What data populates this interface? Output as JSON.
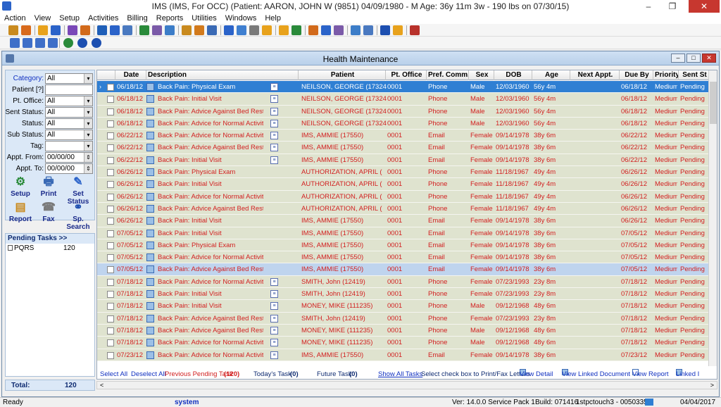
{
  "window": {
    "title": "IMS (IMS, For OCC)    (Patient: AARON, JOHN W (9851) 04/09/1980 - M Age: 36y 11m 3w - 190 lbs on 07/30/15)",
    "min": "–",
    "max": "❐",
    "close": "✕"
  },
  "menu": [
    "Action",
    "View",
    "Setup",
    "Activities",
    "Billing",
    "Reports",
    "Utilities",
    "Windows",
    "Help"
  ],
  "mdi": {
    "title": "Health Maintenance",
    "min": "–",
    "max": "□",
    "close": "✕"
  },
  "filters": [
    {
      "label": "Category:",
      "value": "All",
      "link": true
    },
    {
      "label": "Patient [?]",
      "value": "",
      "link": false
    },
    {
      "label": "Pt. Office:",
      "value": "All",
      "link": false
    },
    {
      "label": "Sent Status:",
      "value": "All",
      "link": false
    },
    {
      "label": "Status:",
      "value": "All",
      "link": false
    },
    {
      "label": "Sub Status:",
      "value": "All",
      "link": false
    },
    {
      "label": "Tag:",
      "value": "",
      "link": false
    },
    {
      "label": "Appt. From:",
      "value": "00/00/00",
      "link": false
    },
    {
      "label": "Appt. To:",
      "value": "00/00/00",
      "link": false
    }
  ],
  "actions": [
    {
      "label": "Setup",
      "icon": "gear-icon",
      "glyph": "⚙"
    },
    {
      "label": "Print",
      "icon": "printer-icon",
      "glyph": "🖶"
    },
    {
      "label": "Set Status",
      "icon": "edit-status-icon",
      "glyph": "✎"
    },
    {
      "label": "Report",
      "icon": "report-icon",
      "glyph": "▤"
    },
    {
      "label": "Fax",
      "icon": "fax-icon",
      "glyph": "☎"
    },
    {
      "label": "Sp. Search",
      "icon": "binoculars-icon",
      "glyph": "⚭"
    }
  ],
  "pending": {
    "header": "Pending Tasks >>",
    "items": [
      {
        "name": "PQRS",
        "count": "120"
      }
    ]
  },
  "total": {
    "label": "Total:",
    "value": "120"
  },
  "columns": [
    "Date",
    "Description",
    "Patient",
    "Pt. Office",
    "Pref. Comm.",
    "Sex",
    "DOB",
    "Age",
    "Next Appt.",
    "Due By",
    "Priority",
    "Sent St"
  ],
  "rows": [
    {
      "date": "06/18/12",
      "desc": "Back Pain: Physical Exam",
      "rep": true,
      "patient": "NEILSON, GEORGE  (17324",
      "office": "0001",
      "comm": "Phone",
      "sex": "Male",
      "dob": "12/03/1960",
      "age": "56y 4m",
      "next": "",
      "due": "06/18/12",
      "priority": "Medium",
      "sent": "Pending",
      "state": "sel1"
    },
    {
      "date": "06/18/12",
      "desc": "Back Pain: Initial Visit",
      "rep": true,
      "patient": "NEILSON, GEORGE  (17324",
      "office": "0001",
      "comm": "Phone",
      "sex": "Male",
      "dob": "12/03/1960",
      "age": "56y 4m",
      "next": "",
      "due": "06/18/12",
      "priority": "Medium",
      "sent": "Pending",
      "state": ""
    },
    {
      "date": "06/18/12",
      "desc": "Back Pain: Advice Against Bed Rest",
      "rep": true,
      "patient": "NEILSON, GEORGE  (17324",
      "office": "0001",
      "comm": "Phone",
      "sex": "Male",
      "dob": "12/03/1960",
      "age": "56y 4m",
      "next": "",
      "due": "06/18/12",
      "priority": "Medium",
      "sent": "Pending",
      "state": ""
    },
    {
      "date": "06/18/12",
      "desc": "Back Pain: Advice for Normal Activities",
      "rep": true,
      "patient": "NEILSON, GEORGE  (17324",
      "office": "0001",
      "comm": "Phone",
      "sex": "Male",
      "dob": "12/03/1960",
      "age": "56y 4m",
      "next": "",
      "due": "06/18/12",
      "priority": "Medium",
      "sent": "Pending",
      "state": ""
    },
    {
      "date": "06/22/12",
      "desc": "Back Pain: Advice for Normal Activities",
      "rep": true,
      "patient": "IMS, AMMIE  (17550)",
      "office": "0001",
      "comm": "Email",
      "sex": "Female",
      "dob": "09/14/1978",
      "age": "38y 6m",
      "next": "",
      "due": "06/22/12",
      "priority": "Medium",
      "sent": "Pending",
      "state": ""
    },
    {
      "date": "06/22/12",
      "desc": "Back Pain: Advice Against Bed Rest",
      "rep": true,
      "patient": "IMS, AMMIE  (17550)",
      "office": "0001",
      "comm": "Email",
      "sex": "Female",
      "dob": "09/14/1978",
      "age": "38y 6m",
      "next": "",
      "due": "06/22/12",
      "priority": "Medium",
      "sent": "Pending",
      "state": ""
    },
    {
      "date": "06/22/12",
      "desc": "Back Pain: Initial Visit",
      "rep": true,
      "patient": "IMS, AMMIE  (17550)",
      "office": "0001",
      "comm": "Email",
      "sex": "Female",
      "dob": "09/14/1978",
      "age": "38y 6m",
      "next": "",
      "due": "06/22/12",
      "priority": "Medium",
      "sent": "Pending",
      "state": ""
    },
    {
      "date": "06/26/12",
      "desc": "Back Pain: Physical Exam",
      "rep": false,
      "patient": "AUTHORIZATION, APRIL  (",
      "office": "0001",
      "comm": "Phone",
      "sex": "Female",
      "dob": "11/18/1967",
      "age": "49y 4m",
      "next": "",
      "due": "06/26/12",
      "priority": "Medium",
      "sent": "Pending",
      "state": ""
    },
    {
      "date": "06/26/12",
      "desc": "Back Pain: Initial Visit",
      "rep": false,
      "patient": "AUTHORIZATION, APRIL  (",
      "office": "0001",
      "comm": "Phone",
      "sex": "Female",
      "dob": "11/18/1967",
      "age": "49y 4m",
      "next": "",
      "due": "06/26/12",
      "priority": "Medium",
      "sent": "Pending",
      "state": ""
    },
    {
      "date": "06/26/12",
      "desc": "Back Pain: Advice for Normal Activities",
      "rep": false,
      "patient": "AUTHORIZATION, APRIL  (",
      "office": "0001",
      "comm": "Phone",
      "sex": "Female",
      "dob": "11/18/1967",
      "age": "49y 4m",
      "next": "",
      "due": "06/26/12",
      "priority": "Medium",
      "sent": "Pending",
      "state": ""
    },
    {
      "date": "06/26/12",
      "desc": "Back Pain: Advice Against Bed Rest",
      "rep": false,
      "patient": "AUTHORIZATION, APRIL  (",
      "office": "0001",
      "comm": "Phone",
      "sex": "Female",
      "dob": "11/18/1967",
      "age": "49y 4m",
      "next": "",
      "due": "06/26/12",
      "priority": "Medium",
      "sent": "Pending",
      "state": ""
    },
    {
      "date": "06/26/12",
      "desc": "Back Pain: Initial Visit",
      "rep": false,
      "patient": "IMS, AMMIE  (17550)",
      "office": "0001",
      "comm": "Email",
      "sex": "Female",
      "dob": "09/14/1978",
      "age": "38y 6m",
      "next": "",
      "due": "06/26/12",
      "priority": "Medium",
      "sent": "Pending",
      "state": ""
    },
    {
      "date": "07/05/12",
      "desc": "Back Pain: Initial Visit",
      "rep": false,
      "patient": "IMS, AMMIE  (17550)",
      "office": "0001",
      "comm": "Email",
      "sex": "Female",
      "dob": "09/14/1978",
      "age": "38y 6m",
      "next": "",
      "due": "07/05/12",
      "priority": "Medium",
      "sent": "Pending",
      "state": ""
    },
    {
      "date": "07/05/12",
      "desc": "Back Pain: Physical Exam",
      "rep": false,
      "patient": "IMS, AMMIE  (17550)",
      "office": "0001",
      "comm": "Email",
      "sex": "Female",
      "dob": "09/14/1978",
      "age": "38y 6m",
      "next": "",
      "due": "07/05/12",
      "priority": "Medium",
      "sent": "Pending",
      "state": ""
    },
    {
      "date": "07/05/12",
      "desc": "Back Pain: Advice for Normal Activities",
      "rep": false,
      "patient": "IMS, AMMIE  (17550)",
      "office": "0001",
      "comm": "Email",
      "sex": "Female",
      "dob": "09/14/1978",
      "age": "38y 6m",
      "next": "",
      "due": "07/05/12",
      "priority": "Medium",
      "sent": "Pending",
      "state": ""
    },
    {
      "date": "07/05/12",
      "desc": "Back Pain: Advice Against Bed Rest",
      "rep": false,
      "patient": "IMS, AMMIE  (17550)",
      "office": "0001",
      "comm": "Email",
      "sex": "Female",
      "dob": "09/14/1978",
      "age": "38y 6m",
      "next": "",
      "due": "07/05/12",
      "priority": "Medium",
      "sent": "Pending",
      "state": "sel2"
    },
    {
      "date": "07/18/12",
      "desc": "Back Pain: Advice for Normal Activities",
      "rep": true,
      "patient": "SMITH, John  (12419)",
      "office": "0001",
      "comm": "Phone",
      "sex": "Female",
      "dob": "07/23/1993",
      "age": "23y 8m",
      "next": "",
      "due": "07/18/12",
      "priority": "Medium",
      "sent": "Pending",
      "state": ""
    },
    {
      "date": "07/18/12",
      "desc": "Back Pain: Initial Visit",
      "rep": true,
      "patient": "SMITH, John  (12419)",
      "office": "0001",
      "comm": "Phone",
      "sex": "Female",
      "dob": "07/23/1993",
      "age": "23y 8m",
      "next": "",
      "due": "07/18/12",
      "priority": "Medium",
      "sent": "Pending",
      "state": ""
    },
    {
      "date": "07/18/12",
      "desc": "Back Pain: Initial Visit",
      "rep": true,
      "patient": "MONEY, MIKE  (111235)",
      "office": "0001",
      "comm": "Phone",
      "sex": "Male",
      "dob": "09/12/1968",
      "age": "48y 6m",
      "next": "",
      "due": "07/18/12",
      "priority": "Medium",
      "sent": "Pending",
      "state": ""
    },
    {
      "date": "07/18/12",
      "desc": "Back Pain: Advice Against Bed Rest",
      "rep": true,
      "patient": "SMITH, John  (12419)",
      "office": "0001",
      "comm": "Phone",
      "sex": "Female",
      "dob": "07/23/1993",
      "age": "23y 8m",
      "next": "",
      "due": "07/18/12",
      "priority": "Medium",
      "sent": "Pending",
      "state": ""
    },
    {
      "date": "07/18/12",
      "desc": "Back Pain: Advice Against Bed Rest",
      "rep": true,
      "patient": "MONEY, MIKE  (111235)",
      "office": "0001",
      "comm": "Phone",
      "sex": "Male",
      "dob": "09/12/1968",
      "age": "48y 6m",
      "next": "",
      "due": "07/18/12",
      "priority": "Medium",
      "sent": "Pending",
      "state": ""
    },
    {
      "date": "07/18/12",
      "desc": "Back Pain: Advice for Normal Activities",
      "rep": true,
      "patient": "MONEY, MIKE  (111235)",
      "office": "0001",
      "comm": "Phone",
      "sex": "Male",
      "dob": "09/12/1968",
      "age": "48y 6m",
      "next": "",
      "due": "07/18/12",
      "priority": "Medium",
      "sent": "Pending",
      "state": ""
    },
    {
      "date": "07/23/12",
      "desc": "Back Pain: Advice for Normal Activities",
      "rep": true,
      "patient": "IMS, AMMIE  (17550)",
      "office": "0001",
      "comm": "Email",
      "sex": "Female",
      "dob": "09/14/1978",
      "age": "38y 6m",
      "next": "",
      "due": "07/23/12",
      "priority": "Medium",
      "sent": "Pending",
      "state": ""
    }
  ],
  "footer": {
    "select_all": "Select All",
    "deselect_all": "Deselect All",
    "prev_pending": "Previous Pending Task",
    "prev_pending_count": "(120)",
    "today": "Today's Task",
    "today_count": "(0)",
    "future": "Future Task",
    "future_count": "(0)",
    "show_all": "Show All Tasks",
    "hint": "Select check box to Print/Fax Letters",
    "view_detail": "View Detail",
    "view_linked": "View Linked Document",
    "view_report": "View Report",
    "linked": "Linked I"
  },
  "statusbar": {
    "ready": "Ready",
    "user": "system",
    "version": "Ver: 14.0.0 Service Pack 1",
    "build": "Build: 071416",
    "host": "1stpctouch3 - 0050335",
    "date": "04/04/2017"
  },
  "colors": {
    "row_bg": "#dfe3cf",
    "row_text": "#d22020",
    "selected_row": "#2f7fd3",
    "highlight_row": "#bfd4ee",
    "link": "#1030c0"
  }
}
